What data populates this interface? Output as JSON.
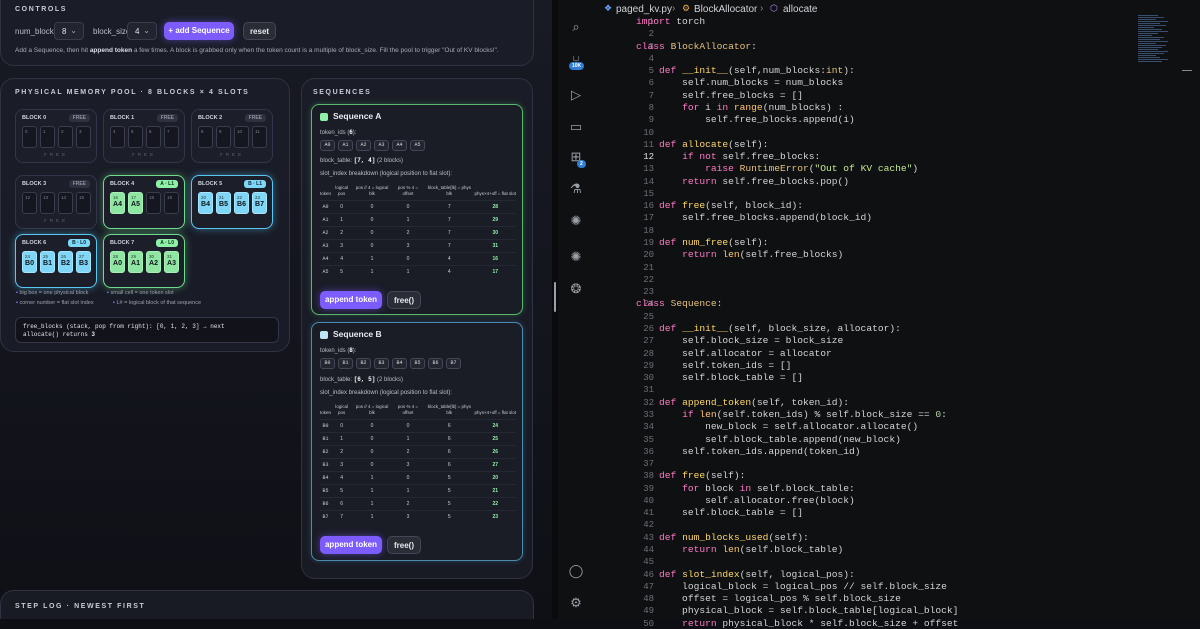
{
  "controls": {
    "title": "CONTROLS",
    "num_blocks_label": "num_blocks",
    "num_blocks_value": "8",
    "block_size_label": "block_size",
    "block_size_value": "4",
    "add_button": "+ add Sequence",
    "reset_button": "reset",
    "help_pre": "Add a Sequence, then hit ",
    "help_bold": "append token",
    "help_post": " a few times. A block is grabbed only when the token count is a multiple of block_size. Fill the pool to trigger \"Out of KV blocks!\"."
  },
  "pool": {
    "title": "PHYSICAL MEMORY POOL · 8 BLOCKS × 4 SLOTS",
    "free_text": "FREE",
    "blocks": [
      {
        "name": "BLOCK 0",
        "badge": "FREE",
        "idx": [
          "0",
          "1",
          "2",
          "3"
        ],
        "tokens": [
          "",
          "",
          "",
          ""
        ]
      },
      {
        "name": "BLOCK 1",
        "badge": "FREE",
        "idx": [
          "4",
          "5",
          "6",
          "7"
        ],
        "tokens": [
          "",
          "",
          "",
          ""
        ]
      },
      {
        "name": "BLOCK 2",
        "badge": "FREE",
        "idx": [
          "8",
          "9",
          "10",
          "11"
        ],
        "tokens": [
          "",
          "",
          "",
          ""
        ]
      },
      {
        "name": "BLOCK 3",
        "badge": "FREE",
        "idx": [
          "12",
          "13",
          "14",
          "15"
        ],
        "tokens": [
          "",
          "",
          "",
          ""
        ]
      },
      {
        "name": "BLOCK 4",
        "badge": "A · L1",
        "idx": [
          "16",
          "17",
          "18",
          "19"
        ],
        "tokens": [
          "A4",
          "A5",
          "",
          ""
        ]
      },
      {
        "name": "BLOCK 5",
        "badge": "B · L1",
        "idx": [
          "20",
          "21",
          "22",
          "23"
        ],
        "tokens": [
          "B4",
          "B5",
          "B6",
          "B7"
        ]
      },
      {
        "name": "BLOCK 6",
        "badge": "B · L0",
        "idx": [
          "24",
          "25",
          "26",
          "27"
        ],
        "tokens": [
          "B0",
          "B1",
          "B2",
          "B3"
        ]
      },
      {
        "name": "BLOCK 7",
        "badge": "A · L0",
        "idx": [
          "28",
          "29",
          "30",
          "31"
        ],
        "tokens": [
          "A0",
          "A1",
          "A2",
          "A3"
        ]
      }
    ],
    "legend1a": "big box = one physical block",
    "legend1b": "small cell = one token slot",
    "legend2a": "corner number = flat slot index",
    "legend2b": "L# = logical block of that sequence",
    "free_blocks_line1": "free_blocks (stack, pop from right): [0, 1, 2, 3]  →  next",
    "free_blocks_line2a": "allocate() returns ",
    "free_blocks_line2b": "3"
  },
  "sequences": {
    "title": "SEQUENCES",
    "cols": [
      "token",
      "logical pos",
      "pos // 4 = logical blk",
      "pos % 4 = offset",
      "block_table[lb] = phys blk",
      "phys×4+off = flat slot"
    ],
    "breakdown_label": "slot_index breakdown (logical position to flat slot):",
    "append_button": "append token",
    "free_button": "free()",
    "a": {
      "name": "Sequence A",
      "count_label": "token_ids (",
      "count": "6",
      "count_post": "):",
      "ids": [
        "A0",
        "A1",
        "A2",
        "A3",
        "A4",
        "A5"
      ],
      "bt_label": "block_table: ",
      "bt": "[7, 4]",
      "bt_post": " (2 blocks)",
      "rows": [
        [
          "A0",
          "0",
          "0",
          "0",
          "7",
          "28"
        ],
        [
          "A1",
          "1",
          "0",
          "1",
          "7",
          "29"
        ],
        [
          "A2",
          "2",
          "0",
          "2",
          "7",
          "30"
        ],
        [
          "A3",
          "3",
          "0",
          "3",
          "7",
          "31"
        ],
        [
          "A4",
          "4",
          "1",
          "0",
          "4",
          "16"
        ],
        [
          "A5",
          "5",
          "1",
          "1",
          "4",
          "17"
        ]
      ]
    },
    "b": {
      "name": "Sequence B",
      "count_label": "token_ids (",
      "count": "8",
      "count_post": "):",
      "ids": [
        "B0",
        "B1",
        "B2",
        "B3",
        "B4",
        "B5",
        "B6",
        "B7"
      ],
      "bt_label": "block_table: ",
      "bt": "[6, 5]",
      "bt_post": " (2 blocks)",
      "rows": [
        [
          "B0",
          "0",
          "0",
          "0",
          "6",
          "24"
        ],
        [
          "B1",
          "1",
          "0",
          "1",
          "6",
          "25"
        ],
        [
          "B2",
          "2",
          "0",
          "2",
          "6",
          "26"
        ],
        [
          "B3",
          "3",
          "0",
          "3",
          "6",
          "27"
        ],
        [
          "B4",
          "4",
          "1",
          "0",
          "5",
          "20"
        ],
        [
          "B5",
          "5",
          "1",
          "1",
          "5",
          "21"
        ],
        [
          "B6",
          "6",
          "1",
          "2",
          "5",
          "22"
        ],
        [
          "B7",
          "7",
          "1",
          "3",
          "5",
          "23"
        ]
      ]
    }
  },
  "steplog": {
    "title": "STEP LOG · NEWEST FIRST"
  },
  "editor": {
    "breadcrumb_file": "paged_kv.py",
    "breadcrumb_class": "BlockAllocator",
    "breadcrumb_method": "allocate",
    "badge_10k": "10K",
    "badge_2": "2"
  }
}
